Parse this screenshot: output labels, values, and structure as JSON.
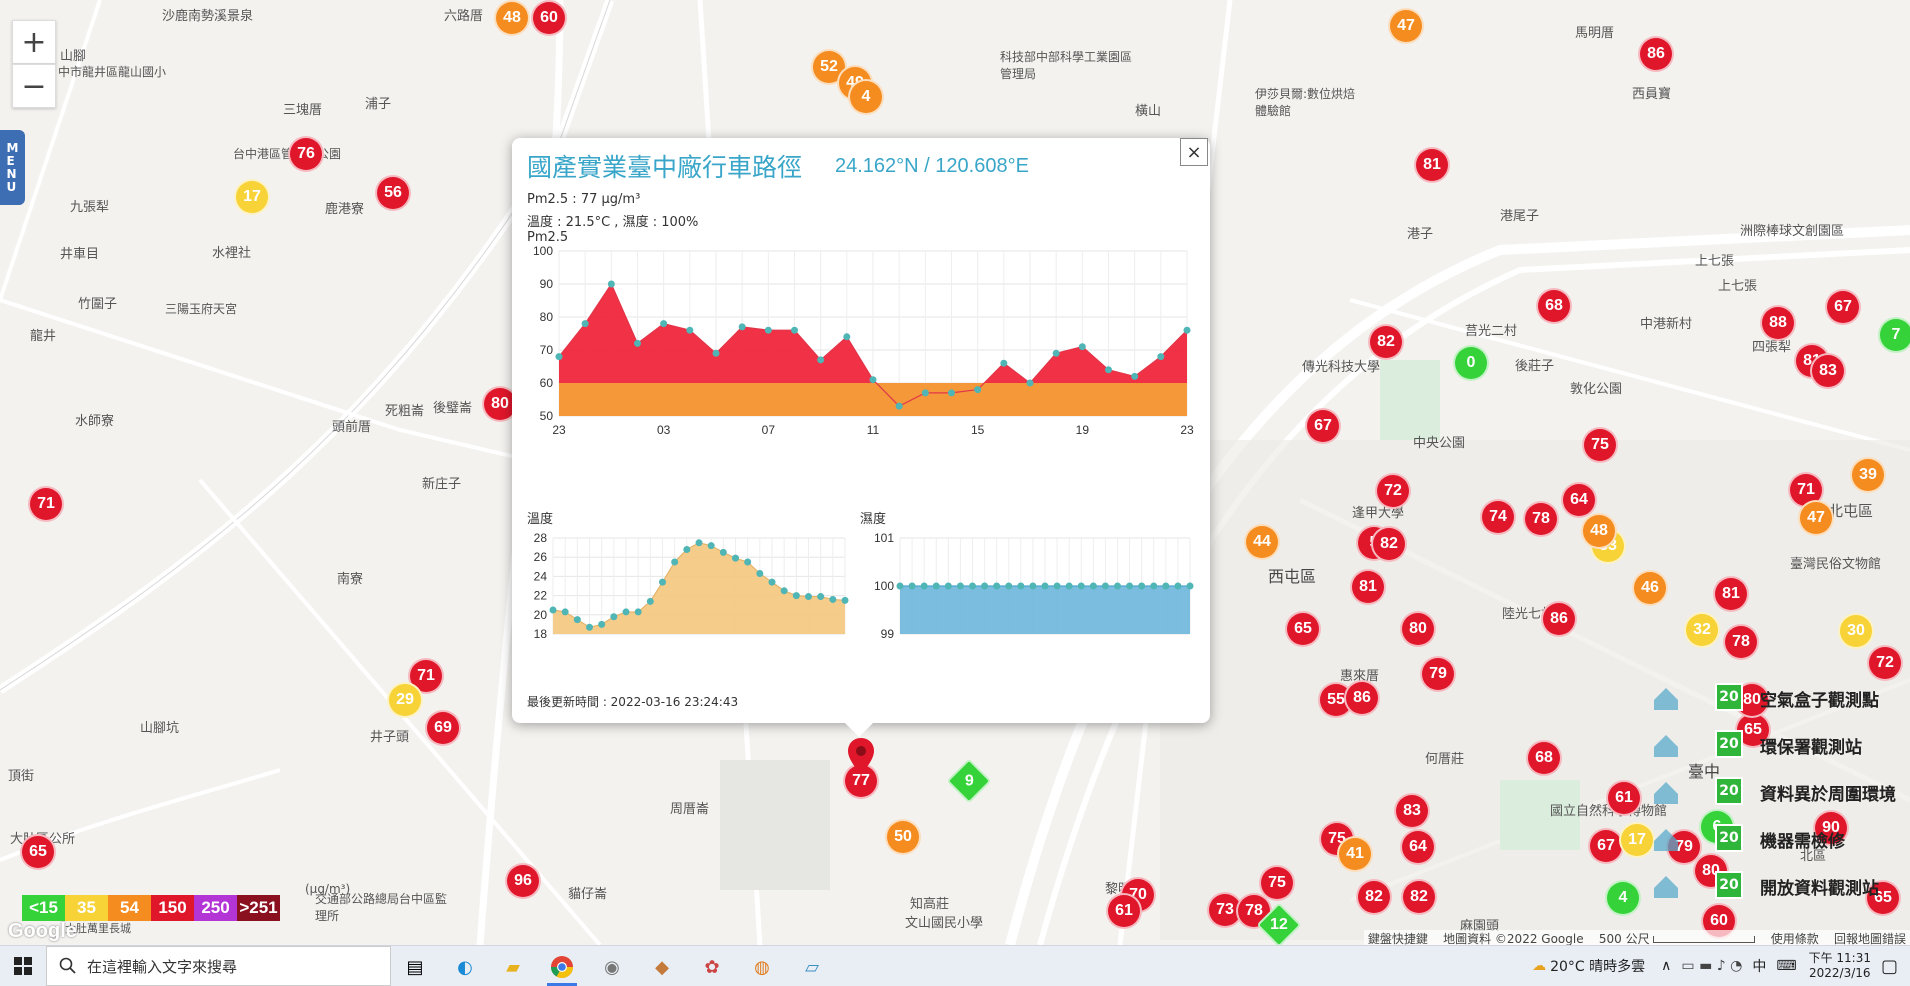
{
  "map": {
    "zoom_in": "+",
    "zoom_out": "−",
    "menu_tab": "MENU",
    "places": [
      {
        "id": "p1",
        "text": "沙鹿南勢溪景泉"
      },
      {
        "id": "p2",
        "text": "六路厝"
      },
      {
        "id": "p3",
        "text": "山腳"
      },
      {
        "id": "p4",
        "text": "中市龍井區龍山國小"
      },
      {
        "id": "p5",
        "text": "三塊厝"
      },
      {
        "id": "p6",
        "text": "浦子"
      },
      {
        "id": "p7",
        "text": "台中港區管理處公園"
      },
      {
        "id": "p8",
        "text": "九張犁"
      },
      {
        "id": "p9",
        "text": "鹿港寮"
      },
      {
        "id": "p10",
        "text": "井車目"
      },
      {
        "id": "p11",
        "text": "水裡社"
      },
      {
        "id": "p12",
        "text": "竹圍子"
      },
      {
        "id": "p13",
        "text": "三陽玉府天宮"
      },
      {
        "id": "p14",
        "text": "龍井"
      },
      {
        "id": "p15",
        "text": "南寮"
      },
      {
        "id": "p16",
        "text": "水師寮"
      },
      {
        "id": "p17",
        "text": "頭前厝"
      },
      {
        "id": "p18",
        "text": "死粗崙"
      },
      {
        "id": "p19",
        "text": "後璧崙"
      },
      {
        "id": "p20",
        "text": "新庄子"
      },
      {
        "id": "p21",
        "text": "井子頭"
      },
      {
        "id": "p22",
        "text": "山腳坑"
      },
      {
        "id": "p23",
        "text": "頂街"
      },
      {
        "id": "p24",
        "text": "大肚區公所"
      },
      {
        "id": "p25",
        "text": "周厝崙"
      },
      {
        "id": "p26",
        "text": "貓仔崙"
      },
      {
        "id": "p27",
        "text": "交通部公路總局台中區監理所"
      },
      {
        "id": "p28",
        "text": "知高莊"
      },
      {
        "id": "p29",
        "text": "文山國民小學"
      },
      {
        "id": "p30",
        "text": "橫山"
      },
      {
        "id": "p31",
        "text": "科技部中部科學工業園區管理局"
      },
      {
        "id": "p32",
        "text": "伊莎貝爾:數位烘焙體驗館"
      },
      {
        "id": "p33",
        "text": "馬明厝"
      },
      {
        "id": "p34",
        "text": "西員寶"
      },
      {
        "id": "p35",
        "text": "港子"
      },
      {
        "id": "p36",
        "text": "港尾子"
      },
      {
        "id": "p37",
        "text": "洲際棒球文創園區"
      },
      {
        "id": "p38",
        "text": "上七張"
      },
      {
        "id": "p39",
        "text": "上七張"
      },
      {
        "id": "p40",
        "text": "莒光二村"
      },
      {
        "id": "p41",
        "text": "後莊子"
      },
      {
        "id": "p42",
        "text": "中港新村"
      },
      {
        "id": "p43",
        "text": "四張犁"
      },
      {
        "id": "p44",
        "text": "傳光科技大學"
      },
      {
        "id": "p45",
        "text": "敦化公園"
      },
      {
        "id": "p46",
        "text": "中央公園"
      },
      {
        "id": "p47",
        "text": "西屯區"
      },
      {
        "id": "p48",
        "text": "逢甲大學"
      },
      {
        "id": "p49",
        "text": "陸光七村"
      },
      {
        "id": "p50",
        "text": "惠來厝"
      },
      {
        "id": "p51",
        "text": "何厝莊"
      },
      {
        "id": "p52",
        "text": "臺中"
      },
      {
        "id": "p53",
        "text": "北屯區"
      },
      {
        "id": "p54",
        "text": "臺灣民俗文物館"
      },
      {
        "id": "p55",
        "text": "北區"
      },
      {
        "id": "p56",
        "text": "國立自然科學博物館"
      },
      {
        "id": "p57",
        "text": "黎明"
      },
      {
        "id": "p58",
        "text": "麻園頭"
      },
      {
        "id": "p59",
        "text": "大肚萬里長城"
      }
    ],
    "markers": [
      {
        "v": "48",
        "c": "orange"
      },
      {
        "v": "60",
        "c": "red"
      },
      {
        "v": "47",
        "c": "orange"
      },
      {
        "v": "86",
        "c": "red"
      },
      {
        "v": "52",
        "c": "orange"
      },
      {
        "v": "49",
        "c": "orange"
      },
      {
        "v": "4",
        "c": "orange"
      },
      {
        "v": "76",
        "c": "red"
      },
      {
        "v": "56",
        "c": "red"
      },
      {
        "v": "17",
        "c": "yellow"
      },
      {
        "v": "81",
        "c": "red"
      },
      {
        "v": "68",
        "c": "red"
      },
      {
        "v": "67",
        "c": "red"
      },
      {
        "v": "7",
        "c": "green"
      },
      {
        "v": "82",
        "c": "red"
      },
      {
        "v": "0",
        "c": "green"
      },
      {
        "v": "88",
        "c": "red"
      },
      {
        "v": "81",
        "c": "red"
      },
      {
        "v": "83",
        "c": "red"
      },
      {
        "v": "80",
        "c": "red"
      },
      {
        "v": "67",
        "c": "red"
      },
      {
        "v": "71",
        "c": "red"
      },
      {
        "v": "75",
        "c": "red"
      },
      {
        "v": "39",
        "c": "orange"
      },
      {
        "v": "72",
        "c": "red"
      },
      {
        "v": "71",
        "c": "red"
      },
      {
        "v": "47",
        "c": "orange"
      },
      {
        "v": "33",
        "c": "yellow"
      },
      {
        "v": "44",
        "c": "orange"
      },
      {
        "v": "64",
        "c": "red"
      },
      {
        "v": "74",
        "c": "red"
      },
      {
        "v": "78",
        "c": "red"
      },
      {
        "v": "48",
        "c": "orange"
      },
      {
        "v": "5",
        "c": "red"
      },
      {
        "v": "82",
        "c": "red"
      },
      {
        "v": "81",
        "c": "red"
      },
      {
        "v": "46",
        "c": "orange"
      },
      {
        "v": "81",
        "c": "red"
      },
      {
        "v": "65",
        "c": "red"
      },
      {
        "v": "80",
        "c": "red"
      },
      {
        "v": "86",
        "c": "red"
      },
      {
        "v": "32",
        "c": "yellow"
      },
      {
        "v": "78",
        "c": "red"
      },
      {
        "v": "30",
        "c": "yellow"
      },
      {
        "v": "72",
        "c": "red"
      },
      {
        "v": "79",
        "c": "red"
      },
      {
        "v": "55",
        "c": "red"
      },
      {
        "v": "86",
        "c": "red"
      },
      {
        "v": "71",
        "c": "red"
      },
      {
        "v": "29",
        "c": "yellow"
      },
      {
        "v": "69",
        "c": "red"
      },
      {
        "v": "65",
        "c": "red"
      },
      {
        "v": "96",
        "c": "red"
      },
      {
        "v": "77",
        "c": "red"
      },
      {
        "v": "50",
        "c": "orange"
      },
      {
        "v": "68",
        "c": "red"
      },
      {
        "v": "61",
        "c": "red"
      },
      {
        "v": "83",
        "c": "red"
      },
      {
        "v": "75",
        "c": "red"
      },
      {
        "v": "64",
        "c": "red"
      },
      {
        "v": "41",
        "c": "orange"
      },
      {
        "v": "75",
        "c": "red"
      },
      {
        "v": "82",
        "c": "red"
      },
      {
        "v": "82",
        "c": "red"
      },
      {
        "v": "70",
        "c": "red"
      },
      {
        "v": "61",
        "c": "red"
      },
      {
        "v": "73",
        "c": "red"
      },
      {
        "v": "78",
        "c": "red"
      },
      {
        "v": "67",
        "c": "red"
      },
      {
        "v": "17",
        "c": "yellow"
      },
      {
        "v": "79",
        "c": "red"
      },
      {
        "v": "80",
        "c": "red"
      },
      {
        "v": "4",
        "c": "green"
      },
      {
        "v": "60",
        "c": "red"
      },
      {
        "v": "65",
        "c": "red"
      },
      {
        "v": "90",
        "c": "red"
      },
      {
        "v": "65",
        "c": "red"
      },
      {
        "v": "80",
        "c": "red"
      },
      {
        "v": "6",
        "c": "green"
      }
    ],
    "diamonds": [
      {
        "v": "9"
      },
      {
        "v": "12"
      }
    ]
  },
  "aqi_legend": {
    "unit": "(μg/m³)",
    "items": [
      {
        "label": "<15",
        "color": "#35d23a"
      },
      {
        "label": "35",
        "color": "#f7d338"
      },
      {
        "label": "54",
        "color": "#f58c1f"
      },
      {
        "label": "150",
        "color": "#e0162b"
      },
      {
        "label": "250",
        "color": "#b335d6"
      },
      {
        "label": ">251",
        "color": "#8a1020"
      }
    ]
  },
  "popup": {
    "title": "國產實業臺中廠行車路徑",
    "coords": "24.162°N / 120.608°E",
    "close": "×",
    "pm_line": "Pm2.5 : 77 μg/m³",
    "temp_line": "溫度 : 21.5°C , 濕度 : 100%",
    "pm_chart_title": "Pm2.5",
    "temp_chart_title": "溫度",
    "hum_chart_title": "濕度",
    "updated": "最後更新時間 : 2022-03-16 23:24:43"
  },
  "chart_data": [
    {
      "type": "area",
      "title": "Pm2.5",
      "x_ticks": [
        "23",
        "03",
        "07",
        "11",
        "15",
        "19",
        "23"
      ],
      "ylim": [
        50,
        100
      ],
      "y_ticks": [
        50,
        60,
        70,
        80,
        90,
        100
      ],
      "values": [
        68,
        78,
        90,
        72,
        78,
        76,
        69,
        77,
        76,
        76,
        67,
        74,
        61,
        53,
        57,
        57,
        58,
        66,
        60,
        69,
        71,
        64,
        62,
        68,
        76
      ],
      "band_color": "#f5983a",
      "fill_color": "#f0263b",
      "point_color": "#4fb5b5"
    },
    {
      "type": "area",
      "title": "溫度",
      "ylim": [
        18,
        28
      ],
      "y_ticks": [
        18,
        20,
        22,
        24,
        26,
        28
      ],
      "values": [
        20.5,
        20.3,
        19.5,
        18.7,
        19,
        19.8,
        20.3,
        20.3,
        21.4,
        23.4,
        25.5,
        26.8,
        27.5,
        27.2,
        26.5,
        25.9,
        25.5,
        24.3,
        23.4,
        22.5,
        22,
        21.9,
        21.9,
        21.6,
        21.5
      ],
      "fill_color": "#f5c77e",
      "point_color": "#4fb5b5"
    },
    {
      "type": "area",
      "title": "濕度",
      "ylim": [
        99,
        101
      ],
      "y_ticks": [
        99,
        100,
        101
      ],
      "values": [
        100,
        100,
        100,
        100,
        100,
        100,
        100,
        100,
        100,
        100,
        100,
        100,
        100,
        100,
        100,
        100,
        100,
        100,
        100,
        100,
        100,
        100,
        100,
        100,
        100
      ],
      "fill_color": "#6bb6dc",
      "point_color": "#4fb5b5"
    }
  ],
  "legend_panel": {
    "items": [
      {
        "label": "空氣盒子觀測點",
        "badge": "20"
      },
      {
        "label": "環保署觀測站",
        "badge": "20"
      },
      {
        "label": "資料異於周圍環境",
        "badge": "20"
      },
      {
        "label": "機器需檢修",
        "badge": "20"
      },
      {
        "label": "開放資料觀測站",
        "badge": "20"
      }
    ]
  },
  "attribution": {
    "shortcuts": "鍵盤快捷鍵",
    "mapdata": "地圖資料 ©2022 Google",
    "scale": "500 公尺",
    "terms": "使用條款",
    "report": "回報地圖錯誤"
  },
  "google_logo": "Google",
  "taskbar": {
    "search_placeholder": "在這裡輸入文字來搜尋",
    "weather": "20°C  晴時多雲",
    "ime": "中",
    "time": "下午 11:31",
    "date": "2022/3/16"
  }
}
